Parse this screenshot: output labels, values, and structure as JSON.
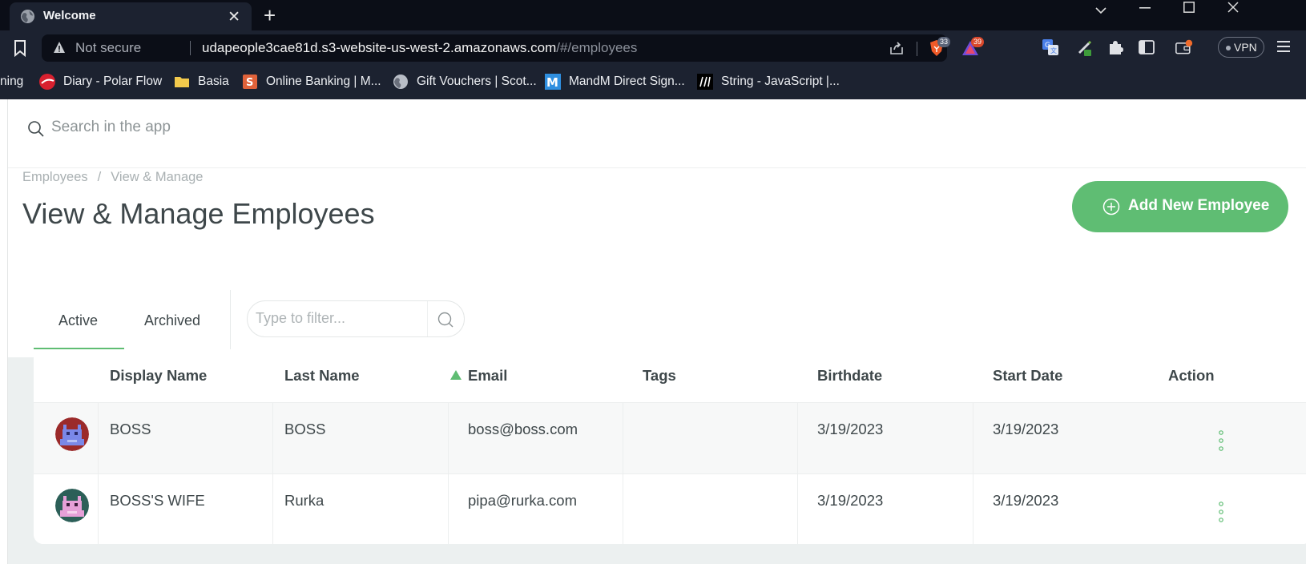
{
  "browser": {
    "tab_title": "Welcome",
    "security_label": "Not secure",
    "url_host": "udapeople3cae81d.s3-website-us-west-2.amazonaws.com",
    "url_path": "/#/employees",
    "shields_count": "33",
    "rewards_count": "39",
    "vpn_label": "VPN",
    "bookmarks": [
      {
        "label": "ning",
        "icon": "partial-bookmark"
      },
      {
        "label": "Diary - Polar Flow",
        "icon": "polar-flow-icon"
      },
      {
        "label": "Basia",
        "icon": "folder-icon"
      },
      {
        "label": "Online Banking | M...",
        "icon": "banking-icon"
      },
      {
        "label": "Gift Vouchers | Scot...",
        "icon": "globe-icon"
      },
      {
        "label": "MandM Direct Sign...",
        "icon": "mandm-icon"
      },
      {
        "label": "String - JavaScript |...",
        "icon": "mdn-icon"
      }
    ]
  },
  "app": {
    "search_placeholder": "Search in the app",
    "breadcrumb": {
      "root": "Employees",
      "sep": "/",
      "current": "View & Manage"
    },
    "page_title": "View & Manage Employees",
    "add_button_label": "Add New Employee",
    "tabs": [
      {
        "label": "Active"
      },
      {
        "label": "Archived"
      }
    ],
    "filter_placeholder": "Type to filter...",
    "accent_color": "#5fbd73",
    "table": {
      "columns": [
        "Display Name",
        "Last Name",
        "Email",
        "Tags",
        "Birthdate",
        "Start Date",
        "Action"
      ],
      "sorted_column": "Email",
      "rows": [
        {
          "display_name": "BOSS",
          "last_name": "BOSS",
          "email": "boss@boss.com",
          "tags": "",
          "birthdate": "3/19/2023",
          "start_date": "3/19/2023"
        },
        {
          "display_name": "BOSS'S WIFE",
          "last_name": "Rurka",
          "email": "pipa@rurka.com",
          "tags": "",
          "birthdate": "3/19/2023",
          "start_date": "3/19/2023"
        }
      ]
    }
  }
}
